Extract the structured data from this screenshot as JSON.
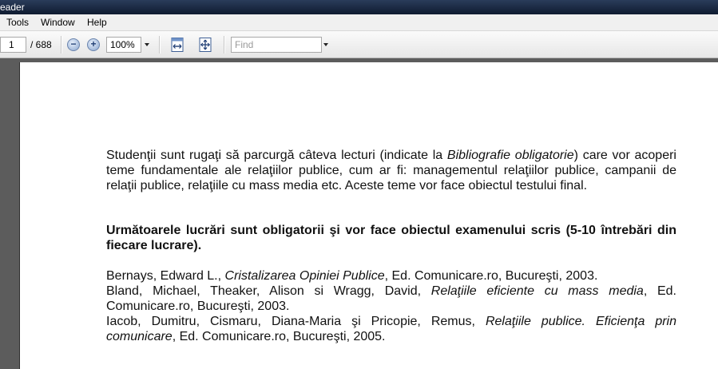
{
  "window": {
    "title": "eader"
  },
  "menu": {
    "items": [
      "Tools",
      "Window",
      "Help"
    ]
  },
  "toolbar": {
    "page_current": "1",
    "page_total": "/ 688",
    "zoom_value": "100%",
    "find_placeholder": "Find",
    "icons": [
      "zoom-out-icon",
      "zoom-in-icon",
      "fit-width-icon",
      "fit-page-icon",
      "dropdown-arrow-icon"
    ]
  },
  "document": {
    "intro": {
      "part1": "Studenţii sunt rugaţi să parcurgă câteva lecturi (indicate la ",
      "italic": "Bibliografie obligatorie",
      "part2": ") care vor acoperi teme fundamentale ale relaţiilor publice, cum ar fi: managementul relaţiilor publice, campanii de relaţii publice, relaţiile cu mass media etc. Aceste teme vor face obiectul testului final."
    },
    "heading": "Următoarele lucrări sunt obligatorii şi vor face obiectul examenului scris (5-10 întrebări din fiecare lucrare).",
    "references": [
      {
        "authors": "Bernays, Edward L., ",
        "title": "Cristalizarea Opiniei Publice",
        "rest": ", Ed. Comunicare.ro, Bucureşti, 2003."
      },
      {
        "authors": "Bland, Michael, Theaker, Alison si Wragg, David, ",
        "title": "Relaţiile eficiente cu mass media",
        "rest": ", Ed. Comunicare.ro, Bucureşti, 2003."
      },
      {
        "authors": "Iacob, Dumitru, Cismaru, Diana-Maria şi Pricopie, Remus, ",
        "title": "Relaţiile publice. Eficienţa prin comunicare",
        "rest": ", Ed. Comunicare.ro, Bucureşti, 2005."
      }
    ]
  }
}
